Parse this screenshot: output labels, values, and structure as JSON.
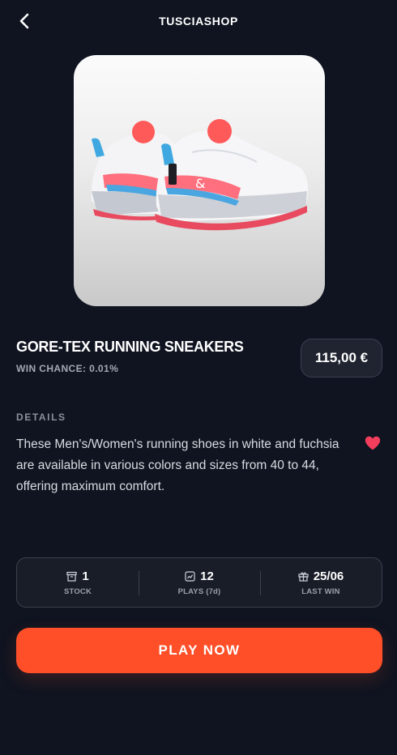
{
  "header": {
    "title": "TUSCIASHOP",
    "back_icon": "chevron-left-icon"
  },
  "product": {
    "image_alt": "sneakers-image",
    "title": "GORE-TEX RUNNING SNEAKERS",
    "win_chance": "WIN CHANCE: 0.01%",
    "price": "115,00 €"
  },
  "details": {
    "label": "DETAILS",
    "description": "These Men's/Women's running shoes in white and fuchsia are available in various colors and sizes from 40 to 44, offering maximum comfort.",
    "favorite_icon": "heart-icon",
    "favorite_color": "#f23d5c"
  },
  "stats": [
    {
      "icon": "box-icon",
      "value": "1",
      "label": "STOCK"
    },
    {
      "icon": "chart-icon",
      "value": "12",
      "label": "PLAYS (7d)"
    },
    {
      "icon": "gift-icon",
      "value": "25/06",
      "label": "LAST WIN"
    }
  ],
  "cta": {
    "label": "PLAY NOW",
    "color": "#ff4f28"
  }
}
